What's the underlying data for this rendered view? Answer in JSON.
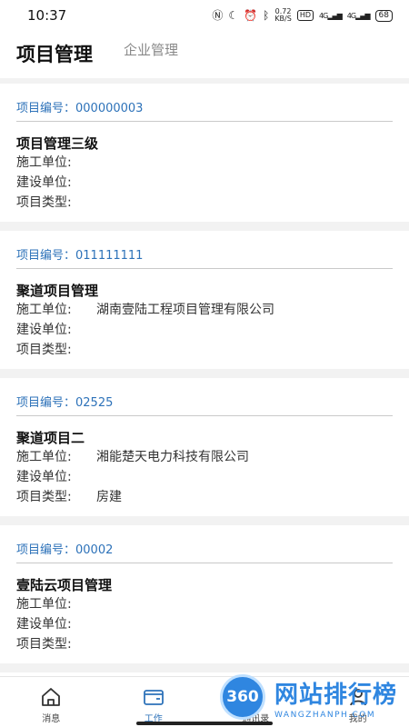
{
  "status_bar": {
    "time": "10:37",
    "net_speed_value": "0.72",
    "net_speed_unit": "KB/S",
    "hd": "HD",
    "signal1": "4G",
    "signal2": "4G",
    "battery": "68"
  },
  "header": {
    "active_tab": "项目管理",
    "inactive_tab": "企业管理"
  },
  "projects": [
    {
      "number_label": "项目编号：",
      "number": "000000003",
      "name": "项目管理三级",
      "construction_label": "施工单位:",
      "construction": "",
      "builder_label": "建设单位:",
      "builder": "",
      "type_label": "项目类型:",
      "type": ""
    },
    {
      "number_label": "项目编号：",
      "number": "011111111",
      "name": "聚道项目管理",
      "construction_label": "施工单位:",
      "construction": "湖南壹陆工程项目管理有限公司",
      "builder_label": "建设单位:",
      "builder": "",
      "type_label": "项目类型:",
      "type": ""
    },
    {
      "number_label": "项目编号：",
      "number": "02525",
      "name": "聚道项目二",
      "construction_label": "施工单位:",
      "construction": "湘能楚天电力科技有限公司",
      "builder_label": "建设单位:",
      "builder": "",
      "type_label": "项目类型:",
      "type": "房建"
    },
    {
      "number_label": "项目编号：",
      "number": "00002",
      "name": "壹陆云项目管理",
      "construction_label": "施工单位:",
      "construction": "",
      "builder_label": "建设单位:",
      "builder": "",
      "type_label": "项目类型:",
      "type": ""
    }
  ],
  "bottom_nav": {
    "items": [
      {
        "label": "消息",
        "icon": "home-icon"
      },
      {
        "label": "工作",
        "icon": "folder-icon"
      },
      {
        "label": "通讯录",
        "icon": "contacts-icon"
      },
      {
        "label": "我的",
        "icon": "user-icon"
      }
    ]
  },
  "watermark": {
    "logo": "360",
    "title": "网站排行榜",
    "subtitle": "WANGZHANPH.COM"
  },
  "colors": {
    "accent": "#2d72b9",
    "watermark": "#2f86e0"
  }
}
